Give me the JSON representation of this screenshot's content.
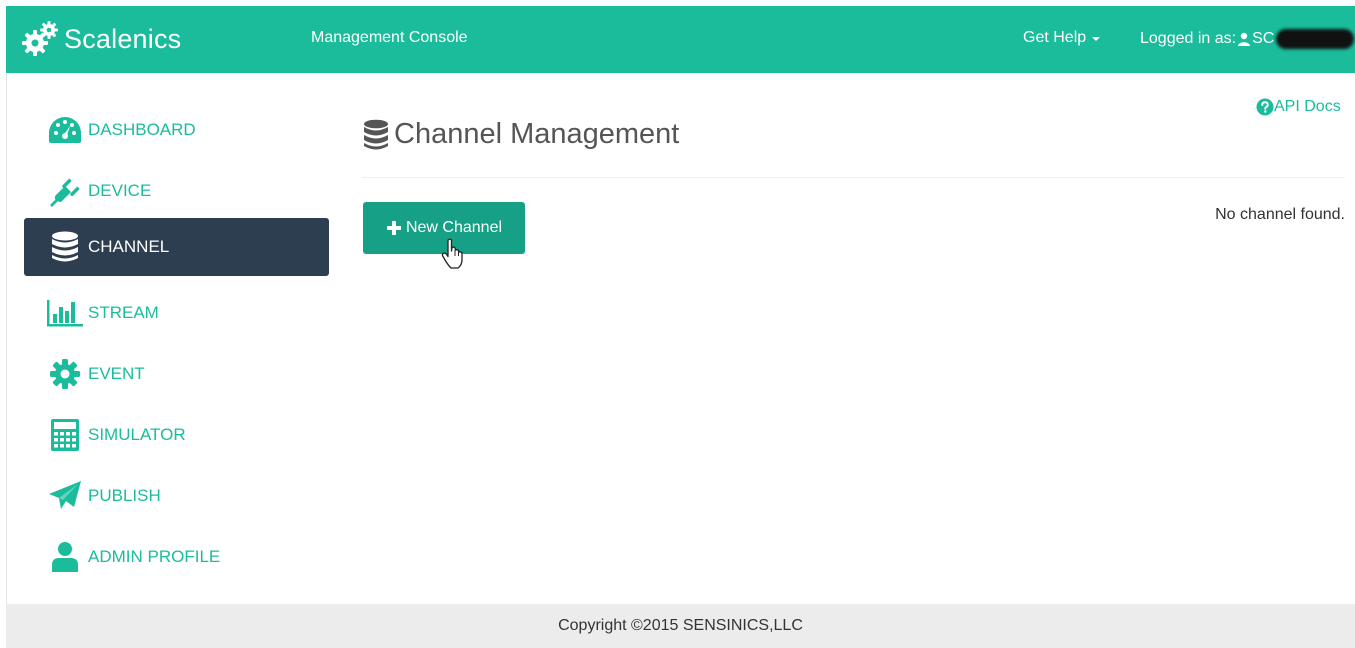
{
  "navbar": {
    "brand": "Scalenics",
    "brand_icon": "gears-icon",
    "console": "Management Console",
    "help": "Get Help",
    "logged_in": "Logged in as:",
    "user_prefix": "SC"
  },
  "sidebar": {
    "items": [
      {
        "label": "DASHBOARD",
        "icon": "dashboard-icon"
      },
      {
        "label": "DEVICE",
        "icon": "plug-icon"
      },
      {
        "label": "CHANNEL",
        "icon": "database-icon",
        "active": true
      },
      {
        "label": "STREAM",
        "icon": "bar-chart-icon"
      },
      {
        "label": "EVENT",
        "icon": "gear-icon"
      },
      {
        "label": "SIMULATOR",
        "icon": "calculator-icon"
      },
      {
        "label": "PUBLISH",
        "icon": "paper-plane-icon"
      },
      {
        "label": "ADMIN PROFILE",
        "icon": "user-icon"
      }
    ]
  },
  "main": {
    "api_docs": "API Docs",
    "title": "Channel Management",
    "new_button": "New Channel",
    "empty_message": "No channel found."
  },
  "footer": {
    "copyright": "Copyright ©2015 SENSINICS,LLC"
  },
  "colors": {
    "brand": "#1abc9c",
    "button": "#16a085",
    "active_sidebar": "#2c3e50",
    "footer_bg": "#ececec"
  }
}
